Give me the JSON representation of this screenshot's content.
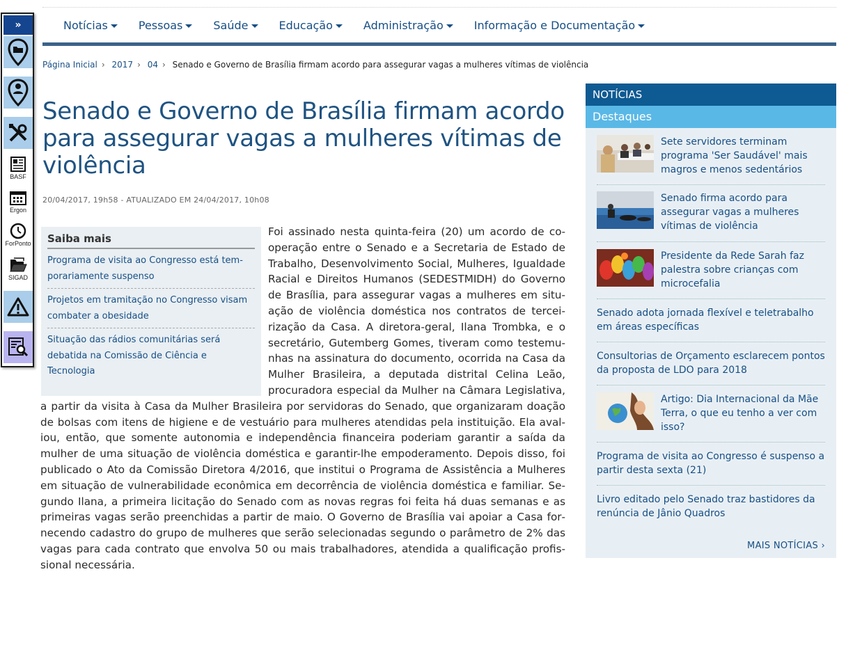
{
  "toolbar": {
    "toggle_glyph": "»",
    "items": [
      {
        "icon": "map-pin-folder-icon",
        "label": ""
      },
      {
        "icon": "map-pin-person-icon",
        "label": ""
      },
      {
        "icon": "tools-icon",
        "label": ""
      },
      {
        "icon": "newspaper-icon",
        "label": "BASF"
      },
      {
        "icon": "calendar-icon",
        "label": "Ergon"
      },
      {
        "icon": "clock-icon",
        "label": "ForPonto"
      },
      {
        "icon": "folder-icon",
        "label": "SIGAD"
      },
      {
        "icon": "warning-icon",
        "label": ""
      },
      {
        "icon": "document-search-icon",
        "label": ""
      }
    ]
  },
  "nav": {
    "items": [
      "Notícias",
      "Pessoas",
      "Saúde",
      "Educação",
      "Administração",
      "Informação e Documentação"
    ]
  },
  "breadcrumb": {
    "items": [
      "Página Inicial",
      "2017",
      "04"
    ],
    "current": "Senado e Governo de Brasília firmam acordo para assegurar vagas a mulheres vítimas de violência"
  },
  "article": {
    "title": "Senado e Governo de Brasília firmam acordo para assegurar vagas a mulheres vítimas de violência",
    "dateline": "20/04/2017, 19h58 - ATUALIZADO EM 24/04/2017, 10h08",
    "body": "Foi assinado nesta quinta-feira (20) um acordo de co­operação entre o Senado e a Secretaria de Estado de Trabalho, Desenvolvimento Social, Mulheres, Igualdade Racial e Direitos Humanos (SEDESTMIDH) do Governo de Brasília, para assegurar vagas a mulheres em situ­ação de violência doméstica nos contratos de tercei­rização da Casa. A diretora-geral, Ilana Trombka, e o secretário, Gutemberg Gomes, tiveram como testemu­nhas na assinatura do documento, ocorrida na Casa da Mulher Brasileira, a deputada distrital Celina Leão, procuradora especial da Mulher na Câmara Legislativa, a partir da visita à Casa da Mulher Brasileira por servidoras do Senado, que organizaram doação de bolsas com itens de higiene e de vestuário para mulheres atendidas pela instituição. Ela aval­iou, então, que somente autonomia e independência financeira poderiam garantir a saída da mulher de uma situação de violência doméstica e garantir-lhe empoderamento. Depois disso, foi publicado o Ato da Comissão Diretora 4/2016, que institui o Programa de Assistência a Mulheres em situação de vulnerabilidade econômica em decorrência de violência doméstica e familiar. Se­gundo Ilana, a primeira licitação do Senado com as novas regras foi feita há duas semanas e as primeiras vagas serão preenchidas a partir de maio. O Governo de Brasília vai apoiar a Casa for­necendo cadastro do grupo de mulheres que serão selecionadas segundo o parâmetro de 2% das vagas para cada contrato que envolva 50 ou mais trabalhadores, atendida a qualificação profis­sional necessária."
  },
  "saiba_mais": {
    "heading": "Saiba mais",
    "items": [
      "Programa de visita ao Congresso está tem­porariamente suspenso",
      "Projetos em tramitação no Congresso visam combater a obesidade",
      "Situação das rádios comunitárias será debatida na Comissão de Ciência e Tecnologia"
    ]
  },
  "sidebar": {
    "heading": "NOTÍCIAS",
    "subheading": "Destaques",
    "items": [
      {
        "text": "Sete servidores terminam programa 'Ser Saudável' mais magros e menos sedentários",
        "thumb": "meeting-photo"
      },
      {
        "text": "Senado firma acordo para assegurar vagas a mulheres vítimas de violência",
        "thumb": "gym-photo"
      },
      {
        "text": "Presidente da Rede Sarah faz palestra sobre crianças com microcefalia",
        "thumb": "painted-hands-photo"
      },
      {
        "text": "Senado adota jornada flexível e teletrabalho em áreas específicas",
        "thumb": ""
      },
      {
        "text": "Consultorias de Orçamento esclarecem pontos da proposta de LDO para 2018",
        "thumb": ""
      },
      {
        "text": "Artigo: Dia Internacional da Mãe Terra, o que eu tenho a ver com isso?",
        "thumb": "earth-woman-photo"
      },
      {
        "text": "Programa de visita ao Congresso é suspenso a partir desta sexta (21)",
        "thumb": ""
      },
      {
        "text": "Livro editado pelo Senado traz bastidores da renúncia de Jânio Quadros",
        "thumb": ""
      }
    ],
    "more": "MAIS NOTÍCIAS ›"
  }
}
